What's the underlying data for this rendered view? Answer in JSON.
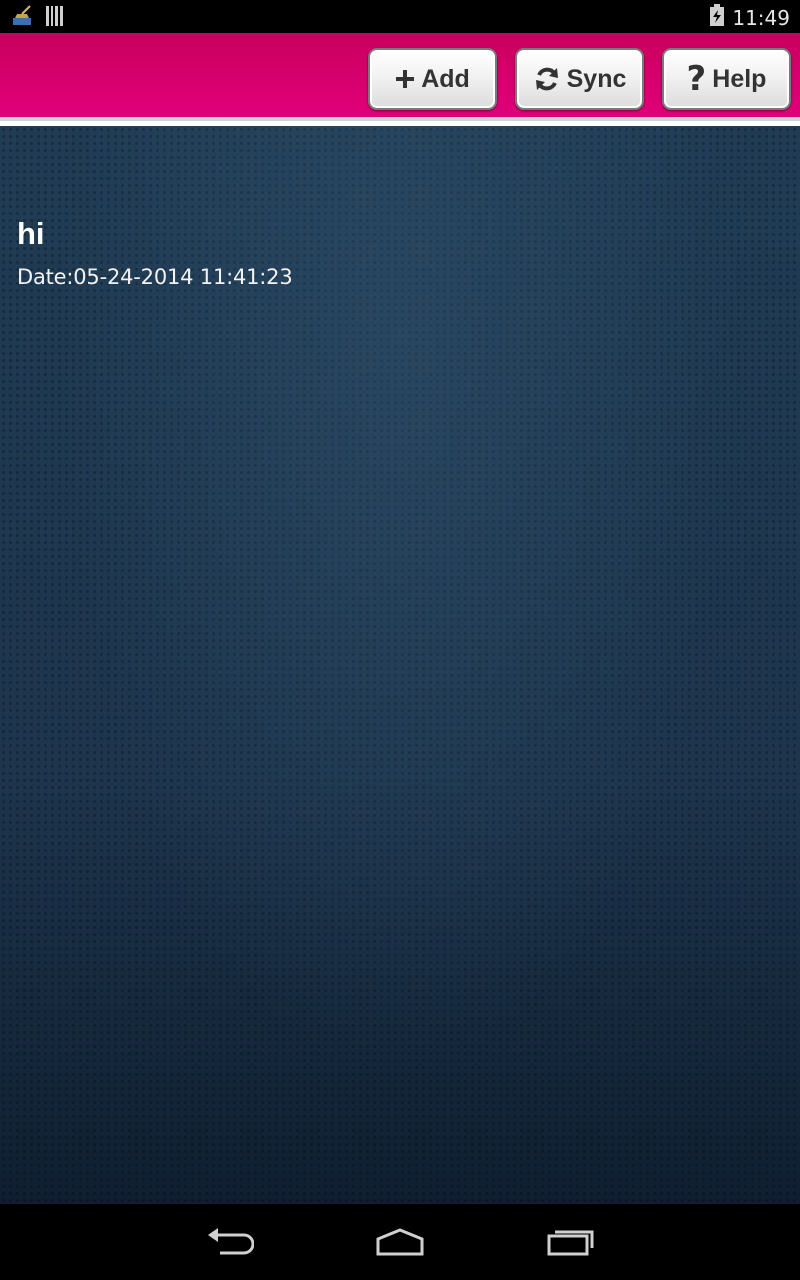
{
  "status_bar": {
    "time": "11:49",
    "left_icons": [
      "broom-notification-icon",
      "barcode-notification-icon"
    ],
    "right_icons": [
      "battery-charging-icon"
    ]
  },
  "header": {
    "accent_color": "#d5006a",
    "buttons": [
      {
        "label": "Add",
        "icon": "plus-icon"
      },
      {
        "label": "Sync",
        "icon": "refresh-icon"
      },
      {
        "label": "Help",
        "icon": "question-icon"
      }
    ]
  },
  "notes": [
    {
      "title": "hi",
      "date": "Date:05-24-2014 11:41:23"
    }
  ],
  "nav_bar": {
    "buttons": [
      "back-icon",
      "home-icon",
      "recent-apps-icon"
    ]
  }
}
